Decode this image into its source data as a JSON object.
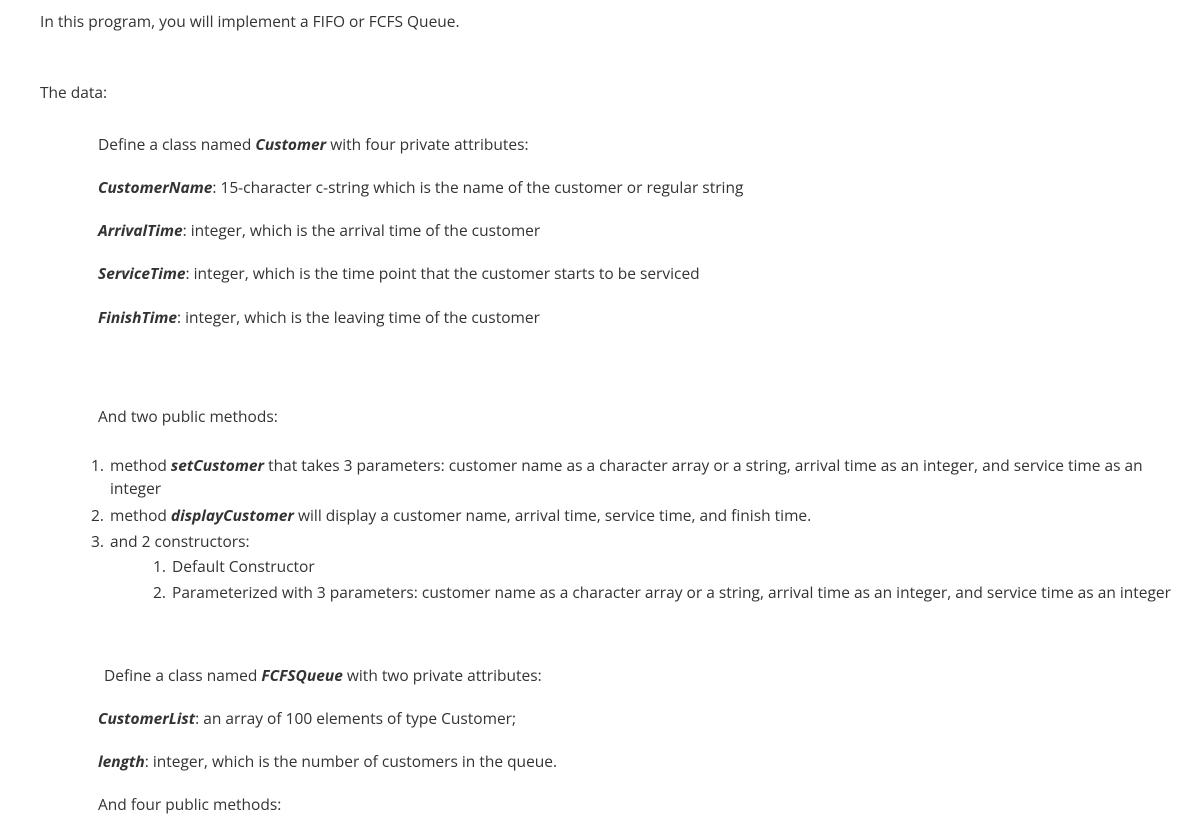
{
  "intro": "In this program, you will implement a FIFO or FCFS Queue.",
  "data_heading": "The data:",
  "define_customer_pre": "Define a class named ",
  "customer_class": "Customer",
  "define_customer_post": " with four private attributes:",
  "attrs": [
    {
      "name": "CustomerName",
      "desc": ": 15-character c-string which is the name of the customer or regular string"
    },
    {
      "name": "ArrivalTime",
      "desc": ": integer, which is the arrival time of the customer"
    },
    {
      "name": "ServiceTime",
      "desc": ": integer, which is the time point that the customer starts to be serviced"
    },
    {
      "name": "FinishTime",
      "desc": ": integer, which is the leaving time of the customer"
    }
  ],
  "two_methods": "And two public methods:",
  "li1_pre": "method ",
  "li1_bold": "setCustomer",
  "li1_post": " that takes 3 parameters: customer name as a character array or a string, arrival time as an integer, and service time as an integer",
  "li2_pre": "method ",
  "li2_bold": "displayCustomer",
  "li2_post": " will display a customer name, arrival time, service time, and finish time.",
  "li3": "and 2 constructors:",
  "sub1": "Default Constructor",
  "sub2": "Parameterized with 3 parameters:  customer name as a character array or a string, arrival time as an integer, and service time as an integer",
  "define_fcfs_pre": "Define a class named ",
  "fcfs_class": "FCFSQueue",
  "define_fcfs_post": " with two private attributes:",
  "attrs2": [
    {
      "name": "CustomerList",
      "desc": ": an array of 100 elements of type Customer;"
    },
    {
      "name": "length",
      "desc": ": integer, which is the number of customers in the queue."
    }
  ],
  "four_methods": "And four public methods:"
}
